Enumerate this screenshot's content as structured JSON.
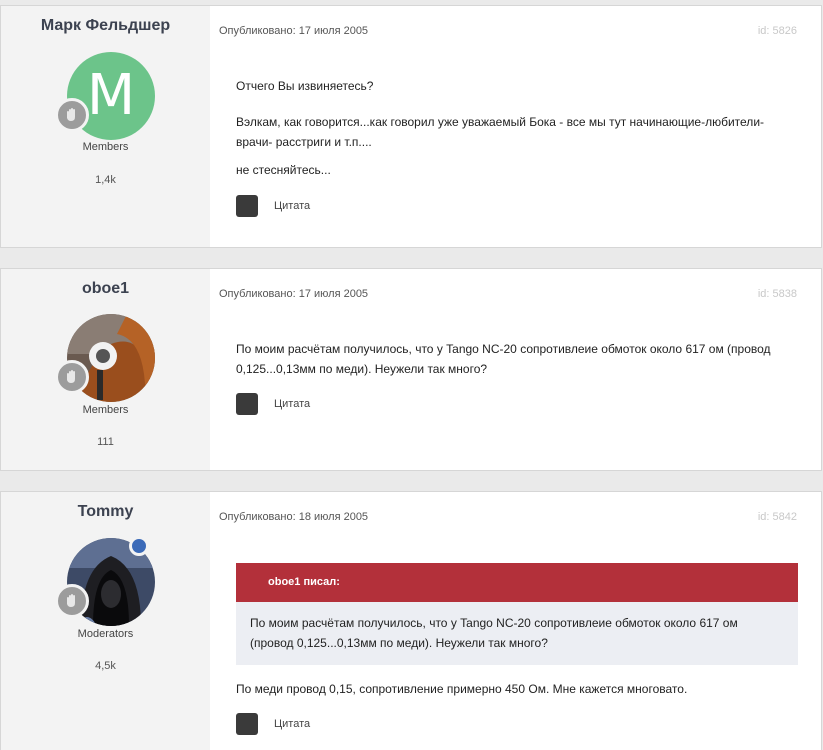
{
  "posts": [
    {
      "author": "Марк Фельдшер",
      "avatar_letter": "M",
      "group": "Members",
      "reputation": "1,4k",
      "date": "Опубликовано: 17 июля 2005",
      "post_id": "id: 5826",
      "paragraphs": [
        "Отчего Вы извиняетесь?",
        "Вэлкам, как говорится...как говорил уже уважаемый Бока - все мы тут начинающие-любители-врачи- расстриги и т.п....",
        "не стесняйтесь..."
      ],
      "quote_label": "Цитата"
    },
    {
      "author": "oboe1",
      "group": "Members",
      "reputation": "111",
      "date": "Опубликовано: 17 июля 2005",
      "post_id": "id: 5838",
      "paragraphs": [
        "По моим расчётам получилось, что у Tango NC-20 сопротивлеие обмоток около 617 ом (провод 0,125...0,13мм по меди). Неужели так много?"
      ],
      "quote_label": "Цитата"
    },
    {
      "author": "Tommy",
      "group": "Moderators",
      "reputation": "4,5k",
      "date": "Опубликовано: 18 июля 2005",
      "post_id": "id: 5842",
      "quote": {
        "header": "oboe1 писал:",
        "text": "По моим расчётам получилось, что у Tango NC-20 сопротивлеие обмоток около 617 ом (провод 0,125...0,13мм по меди). Неужели так много?"
      },
      "paragraphs": [
        "По меди провод 0,15, сопротивление примерно 450 Ом. Мне кажется многовато."
      ],
      "quote_label": "Цитата"
    }
  ],
  "colors": {
    "avatar_green": "#6cc48a",
    "quote_header": "#b3303a",
    "online_dot": "#3b6ab8"
  }
}
